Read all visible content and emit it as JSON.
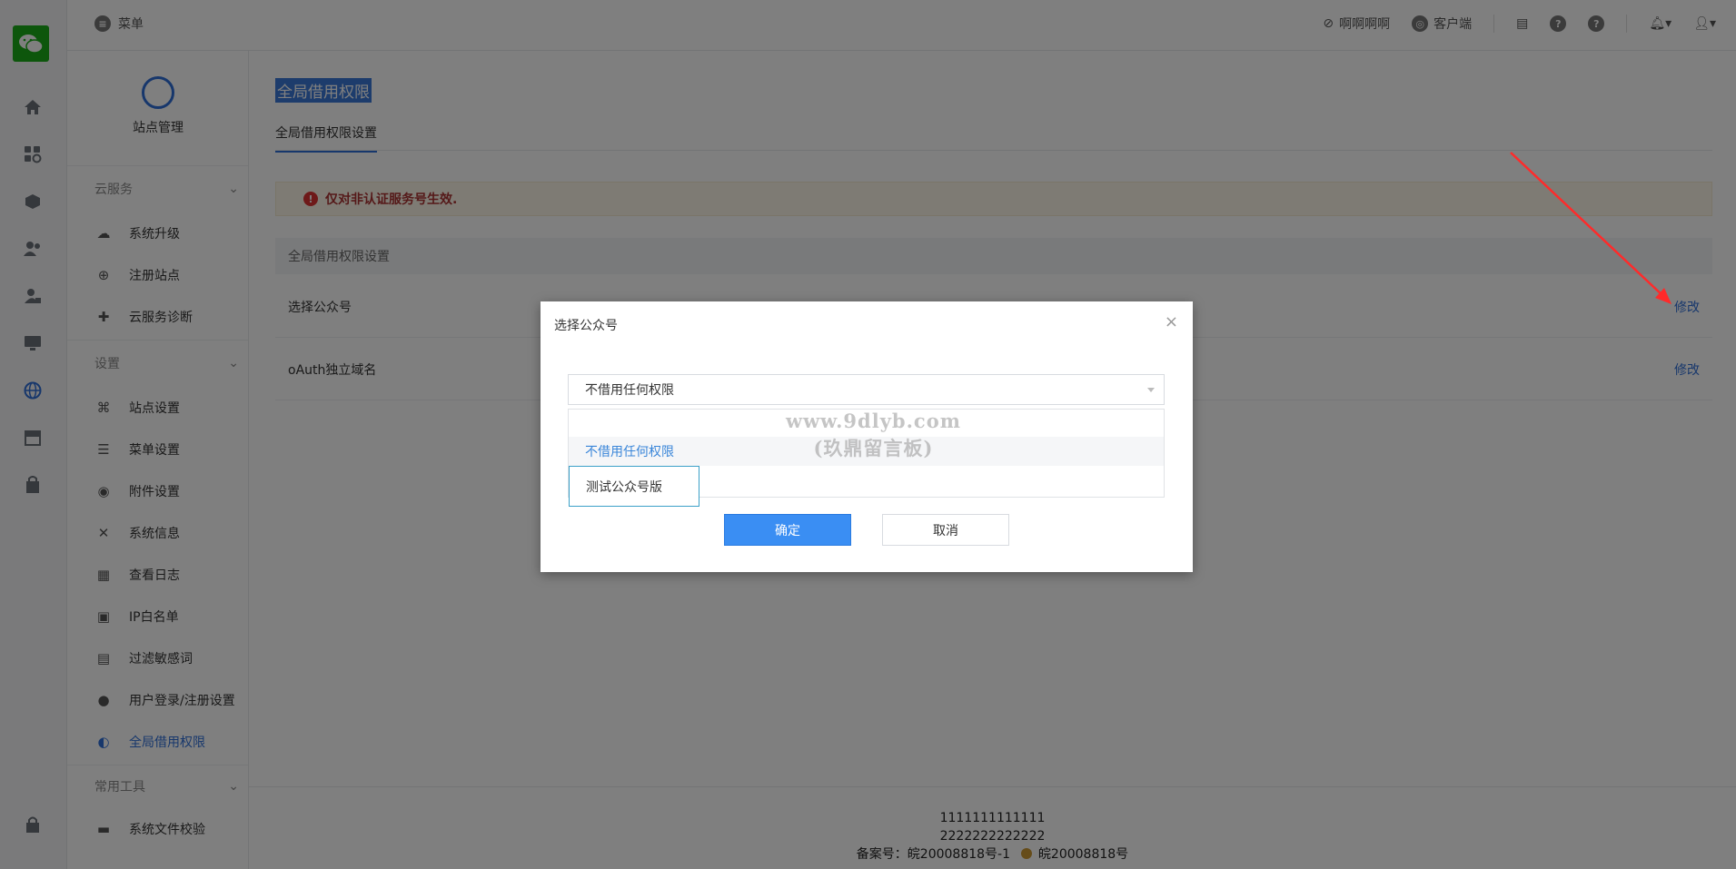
{
  "topbar": {
    "menu_label": "菜单",
    "right_items": [
      {
        "label": "啊啊啊啊",
        "icon": "ban-icon"
      },
      {
        "label": "客户端",
        "icon": "globe-icon"
      }
    ],
    "icons": [
      "notes-icon",
      "help-icon",
      "help-icon",
      "bell-icon",
      "user-icon"
    ]
  },
  "rail": {
    "icons": [
      "home-icon",
      "apps-icon",
      "cubes-icon",
      "users-icon",
      "user-lock-icon",
      "monitor-icon",
      "globe-icon",
      "store-icon",
      "bag-icon",
      "lock-icon"
    ],
    "active": "globe-icon"
  },
  "sidebar": {
    "site_title": "站点管理",
    "groups": [
      {
        "label": "云服务",
        "items": [
          {
            "label": "系统升级",
            "icon": "cloud-icon"
          },
          {
            "label": "注册站点",
            "icon": "plus-circle-icon"
          },
          {
            "label": "云服务诊断",
            "icon": "first-aid-icon"
          }
        ]
      },
      {
        "label": "设置",
        "items": [
          {
            "label": "站点设置",
            "icon": "sitemap-icon"
          },
          {
            "label": "菜单设置",
            "icon": "list-icon"
          },
          {
            "label": "附件设置",
            "icon": "attachment-icon"
          },
          {
            "label": "系统信息",
            "icon": "tools-icon"
          },
          {
            "label": "查看日志",
            "icon": "log-icon"
          },
          {
            "label": "IP白名单",
            "icon": "ip-icon"
          },
          {
            "label": "过滤敏感词",
            "icon": "filter-icon"
          },
          {
            "label": "用户登录/注册设置",
            "icon": "user-icon"
          },
          {
            "label": "全局借用权限",
            "icon": "permission-icon"
          }
        ]
      },
      {
        "label": "常用工具",
        "items": [
          {
            "label": "系统文件校验",
            "icon": "folder-icon"
          }
        ]
      }
    ]
  },
  "main": {
    "page_title": "全局借用权限",
    "tab": "全局借用权限设置",
    "alert": "仅对非认证服务号生效.",
    "panel_head": "全局借用权限设置",
    "rows": [
      {
        "label": "选择公众号",
        "action": "修改"
      },
      {
        "label": "oAuth独立域名",
        "action": "修改"
      }
    ]
  },
  "footer": {
    "line1": "1111111111111",
    "line2": "2222222222222",
    "icp": "备案号：皖20008818号-1",
    "police": "皖20008818号"
  },
  "modal": {
    "title": "选择公众号",
    "select_value": "不借用任何权限",
    "options": [
      "不借用任何权限",
      "测试公众号版"
    ],
    "ok_label": "确定",
    "cancel_label": "取消",
    "watermark_line1": "www.9dlyb.com",
    "watermark_line2": "(玖鼎留言板)"
  },
  "colors": {
    "accent": "#2f6fd8",
    "primary_button": "#3a8ef3",
    "alert_text": "#aa3333",
    "annotation_arrow": "#ff2a2a"
  }
}
